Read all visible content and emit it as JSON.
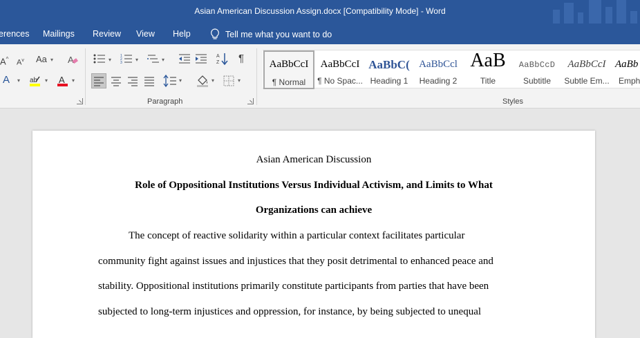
{
  "window": {
    "title": "Asian American Discussion Assign.docx [Compatibility Mode]  -  Word"
  },
  "menu": {
    "items": [
      "erences",
      "Mailings",
      "Review",
      "View",
      "Help"
    ],
    "tell_me": "Tell me what you want to do"
  },
  "ribbon": {
    "font": {
      "grow_label": "A",
      "shrink_label": "A",
      "case_label": "Aa",
      "effects_label": "A",
      "color_label": "A"
    },
    "paragraph_group": "Paragraph",
    "styles_group": "Styles",
    "styles": [
      {
        "preview": "AaBbCcI",
        "name": "¶ Normal"
      },
      {
        "preview": "AaBbCcI",
        "name": "¶ No Spac..."
      },
      {
        "preview": "AaBbC(",
        "name": "Heading 1"
      },
      {
        "preview": "AaBbCcl",
        "name": "Heading 2"
      },
      {
        "preview": "AaB",
        "name": "Title"
      },
      {
        "preview": "AaBbCcD",
        "name": "Subtitle"
      },
      {
        "preview": "AaBbCcI",
        "name": "Subtle Em..."
      },
      {
        "preview": "AaBb",
        "name": "Emph"
      }
    ]
  },
  "colors": {
    "accent": "#2b579a",
    "highlight": "#ffff00",
    "font_color": "#e81123"
  },
  "document": {
    "title": "Asian American Discussion",
    "heading_line1": "Role of Oppositional Institutions Versus Individual Activism, and Limits to What",
    "heading_line2": "Organizations can achieve",
    "lines": [
      "The concept of reactive solidarity within a particular context facilitates particular",
      "community fight against issues and injustices that they posit detrimental to enhanced peace and",
      "stability. Oppositional institutions primarily constitute participants from parties that have been",
      "subjected to long-term injustices and oppression, for instance, by being subjected to unequal"
    ]
  }
}
